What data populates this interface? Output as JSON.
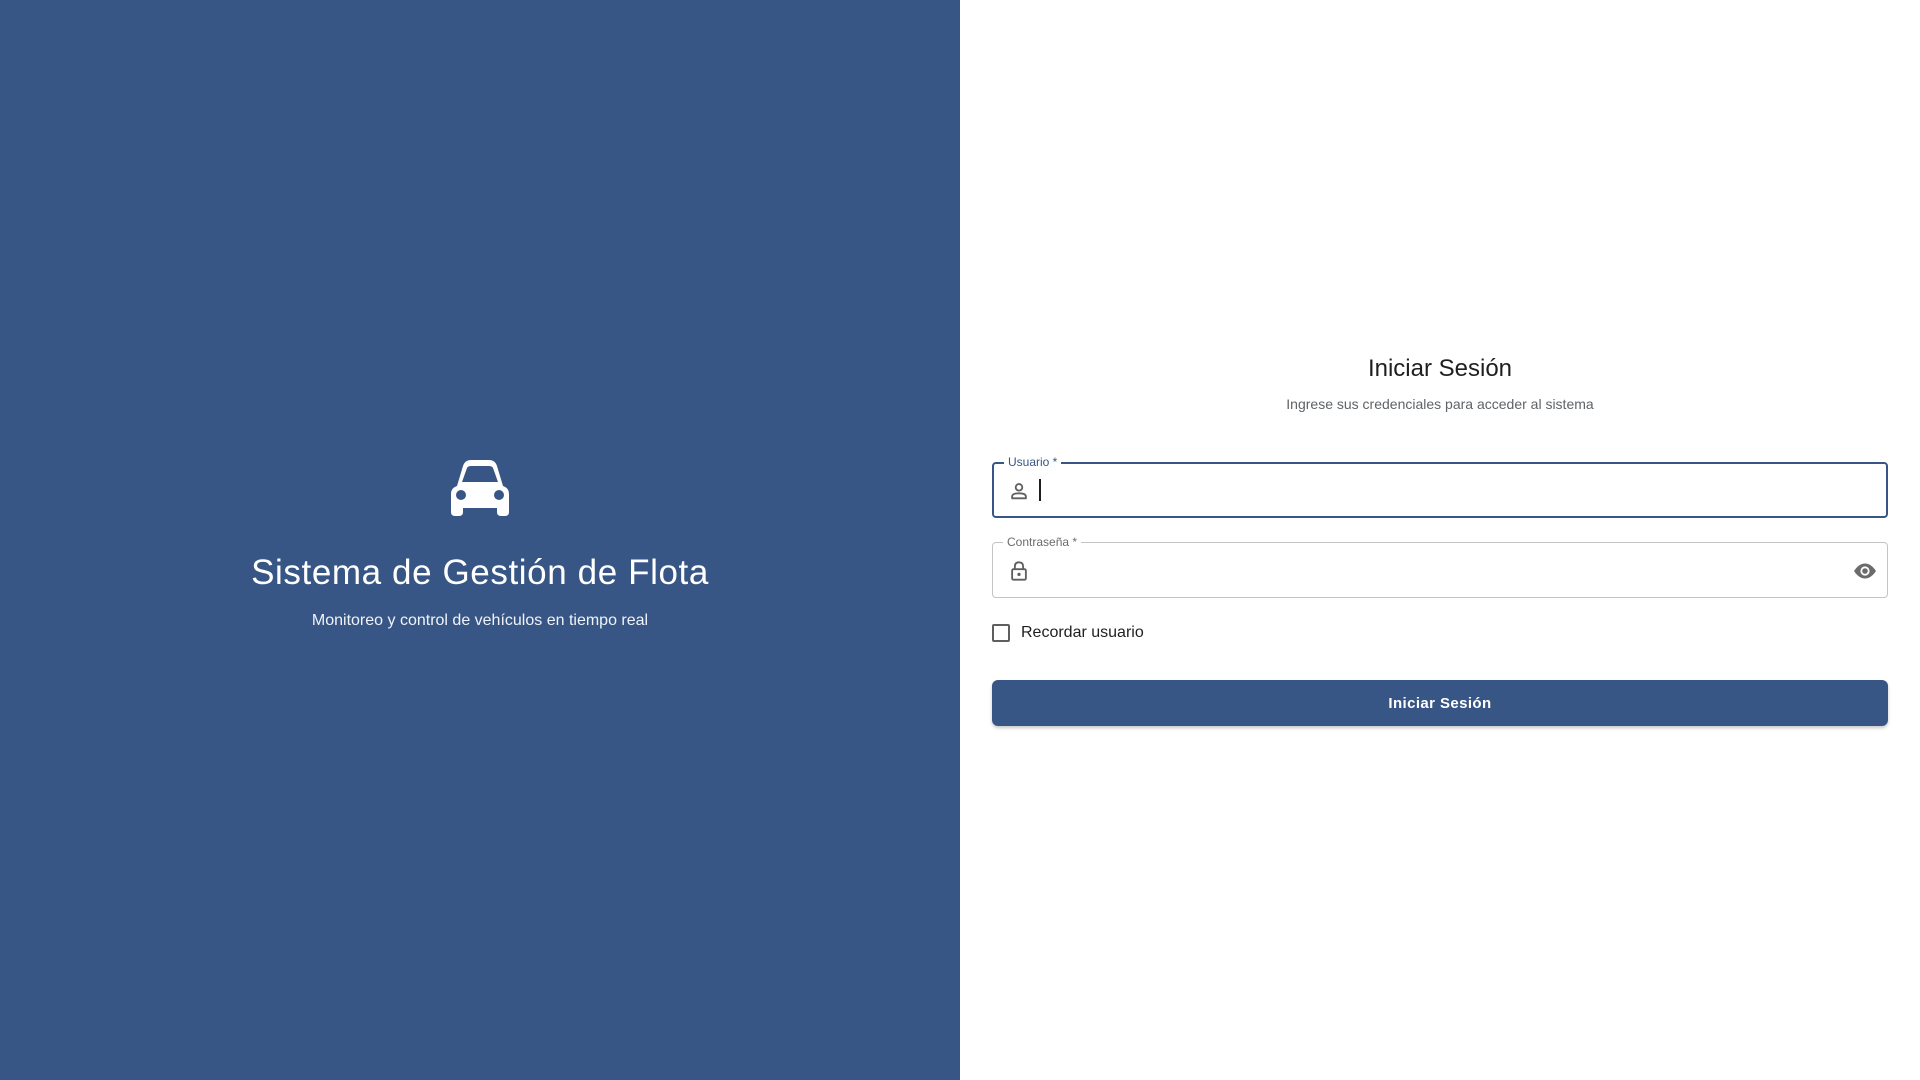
{
  "brand": {
    "icon": "car-icon",
    "title": "Sistema de Gestión de Flota",
    "subtitle": "Monitoreo y control de vehículos en tiempo real"
  },
  "login": {
    "title": "Iniciar Sesión",
    "subtitle": "Ingrese sus credenciales para acceder al sistema",
    "username": {
      "label": "Usuario *",
      "value": "",
      "icon": "person-icon"
    },
    "password": {
      "label": "Contraseña *",
      "value": "",
      "icon": "lock-icon",
      "toggle_icon": "eye-icon"
    },
    "remember_label": "Recordar usuario",
    "remember_checked": false,
    "submit_label": "Iniciar Sesión"
  },
  "colors": {
    "primary": "#375685",
    "background": "#ffffff",
    "text": "#1f1f1f",
    "muted": "#5f6368"
  }
}
